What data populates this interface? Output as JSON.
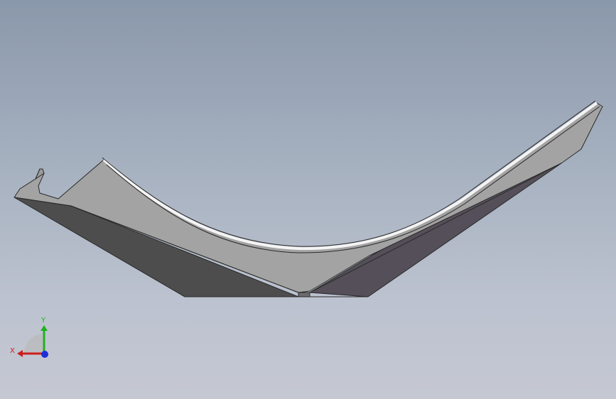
{
  "viewport": {
    "background_top": "#8a98ab",
    "background_bottom": "#c5c8d3"
  },
  "model": {
    "face_light": "#a3a3a3",
    "face_mid": "#8c8c8c",
    "face_dark_left": "#4d4d4d",
    "face_dark_right": "#544f58",
    "edge_color": "#2a2a2a",
    "rim_highlight": "#f4f4f4"
  },
  "triad": {
    "x_label": "X",
    "y_label": "Y",
    "x_color": "#cc1f1f",
    "y_color": "#21b021",
    "z_color": "#1d2fd8"
  }
}
